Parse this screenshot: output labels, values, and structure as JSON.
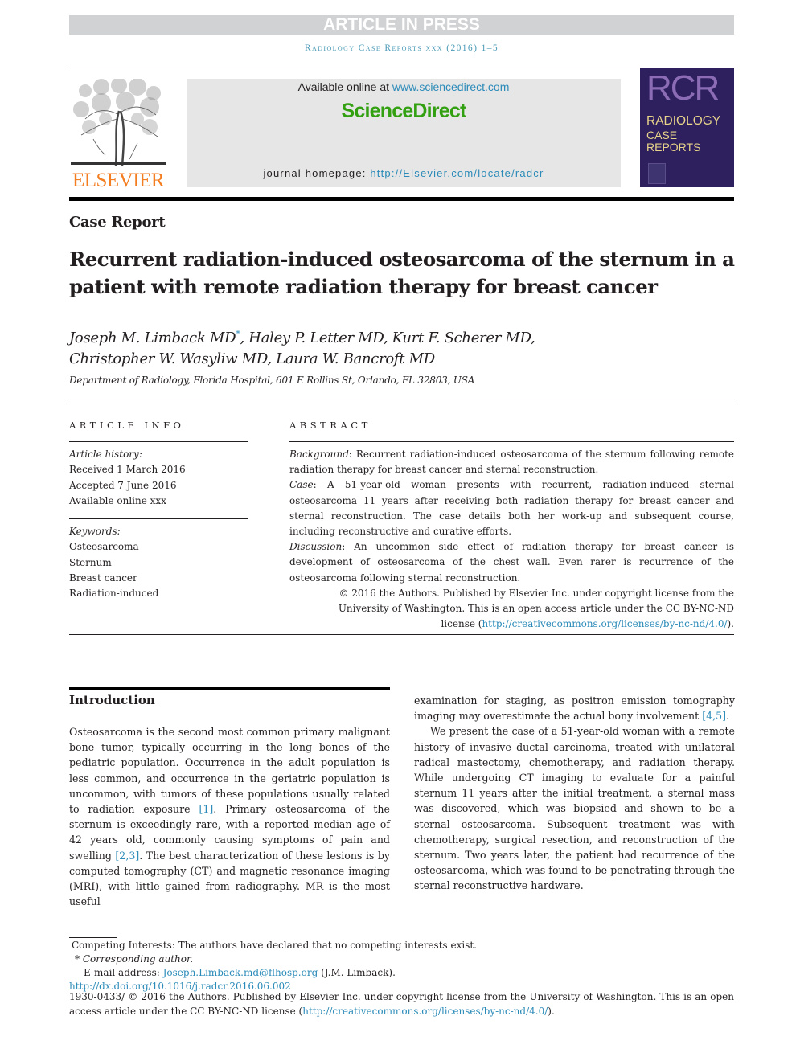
{
  "banner": {
    "status": "ARTICLE IN PRESS",
    "journal_citation": "Radiology Case Reports xxx (2016) 1–5"
  },
  "header": {
    "publisher_logo": "ELSEVIER",
    "available_prefix": "Available online at ",
    "available_link": "www.sciencedirect.com",
    "platform": "ScienceDirect",
    "homepage_prefix": "journal homepage: ",
    "homepage_link": "http://Elsevier.com/locate/radcr",
    "cover": {
      "acronym": "RCR",
      "line1": "RADIOLOGY",
      "line2": "CASE",
      "line3": "REPORTS"
    }
  },
  "article": {
    "type": "Case Report",
    "title": "Recurrent radiation-induced osteosarcoma of the sternum in a patient with remote radiation therapy for breast cancer",
    "authors_line1_first": "Joseph M. Limback MD",
    "corresponding_mark": "*",
    "authors_line1_rest": ", Haley P. Letter MD, Kurt F. Scherer MD,",
    "authors_line2": "Christopher W. Wasyliw MD, Laura W. Bancroft MD",
    "affiliation": "Department of Radiology, Florida Hospital, 601 E Rollins St, Orlando, FL 32803, USA"
  },
  "article_info": {
    "label": "ARTICLE INFO",
    "history_label": "Article history:",
    "history": [
      "Received 1 March 2016",
      "Accepted 7 June 2016",
      "Available online xxx"
    ],
    "keywords_label": "Keywords:",
    "keywords": [
      "Osteosarcoma",
      "Sternum",
      "Breast cancer",
      "Radiation-induced"
    ]
  },
  "abstract": {
    "label": "ABSTRACT",
    "background_label": "Background",
    "background": ": Recurrent radiation-induced osteosarcoma of the sternum following remote radiation therapy for breast cancer and sternal reconstruction.",
    "case_label": "Case",
    "case": ": A 51-year-old woman presents with recurrent, radiation-induced sternal osteosarcoma 11 years after receiving both radiation therapy for breast cancer and sternal reconstruction. The case details both her work-up and subsequent course, including reconstructive and curative efforts.",
    "discussion_label": "Discussion",
    "discussion": ": An uncommon side effect of radiation therapy for breast cancer is development of osteosarcoma of the chest wall. Even rarer is recurrence of the osteosarcoma following sternal reconstruction.",
    "copyright": "© 2016 the Authors. Published by Elsevier Inc. under copyright license from the University of Washington. This is an open access article under the CC BY-NC-ND license (",
    "license_link": "http://creativecommons.org/licenses/by-nc-nd/4.0/",
    "copyright_end": ")."
  },
  "introduction": {
    "heading": "Introduction",
    "left_p1": "Osteosarcoma is the second most common primary malignant bone tumor, typically occurring in the long bones of the pediatric population. Occurrence in the adult population is less common, and occurrence in the geriatric population is uncommon, with tumors of these populations usually related to radiation exposure ",
    "ref1": "[1]",
    "left_p2": ". Primary osteosarcoma of the sternum is exceedingly rare, with a reported median age of 42 years old, commonly causing symptoms of pain and swelling ",
    "ref23": "[2,3]",
    "left_p3": ". The best characterization of these lesions is by computed tomography (CT) and magnetic resonance imaging (MRI), with little gained from radiography. MR is the most useful",
    "right_p1": "examination for staging, as positron emission tomography imaging may overestimate the actual bony involvement ",
    "ref45": "[4,5]",
    "right_p1_end": ".",
    "right_p2": "We present the case of a 51-year-old woman with a remote history of invasive ductal carcinoma, treated with unilateral radical mastectomy, chemotherapy, and radiation therapy. While undergoing CT imaging to evaluate for a painful sternum 11 years after the initial treatment, a sternal mass was discovered, which was biopsied and shown to be a sternal osteosarcoma. Subsequent treatment was with chemotherapy, surgical resection, and reconstruction of the sternum. Two years later, the patient had recurrence of the osteosarcoma, which was found to be penetrating through the sternal reconstructive hardware."
  },
  "footnotes": {
    "competing": "Competing Interests: The authors have declared that no competing interests exist.",
    "corresponding_mark": "* ",
    "corresponding": "Corresponding author.",
    "email_label": "E-mail address: ",
    "email": "Joseph.Limback.md@flhosp.org",
    "email_suffix": " (J.M. Limback).",
    "doi": "http://dx.doi.org/10.1016/j.radcr.2016.06.002",
    "license_text": "1930-0433/ © 2016 the Authors. Published by Elsevier Inc. under copyright license from the University of Washington. This is an open access article under the CC BY-NC-ND license (",
    "license_link": "http://creativecommons.org/licenses/by-nc-nd/4.0/",
    "license_end": ")."
  },
  "colors": {
    "link": "#2a8ab8",
    "sciencedirect_green": "#32a011",
    "elsevier_orange": "#f47d20",
    "cover_purple": "#2e1f5e",
    "banner_gray": "#d1d2d4"
  }
}
